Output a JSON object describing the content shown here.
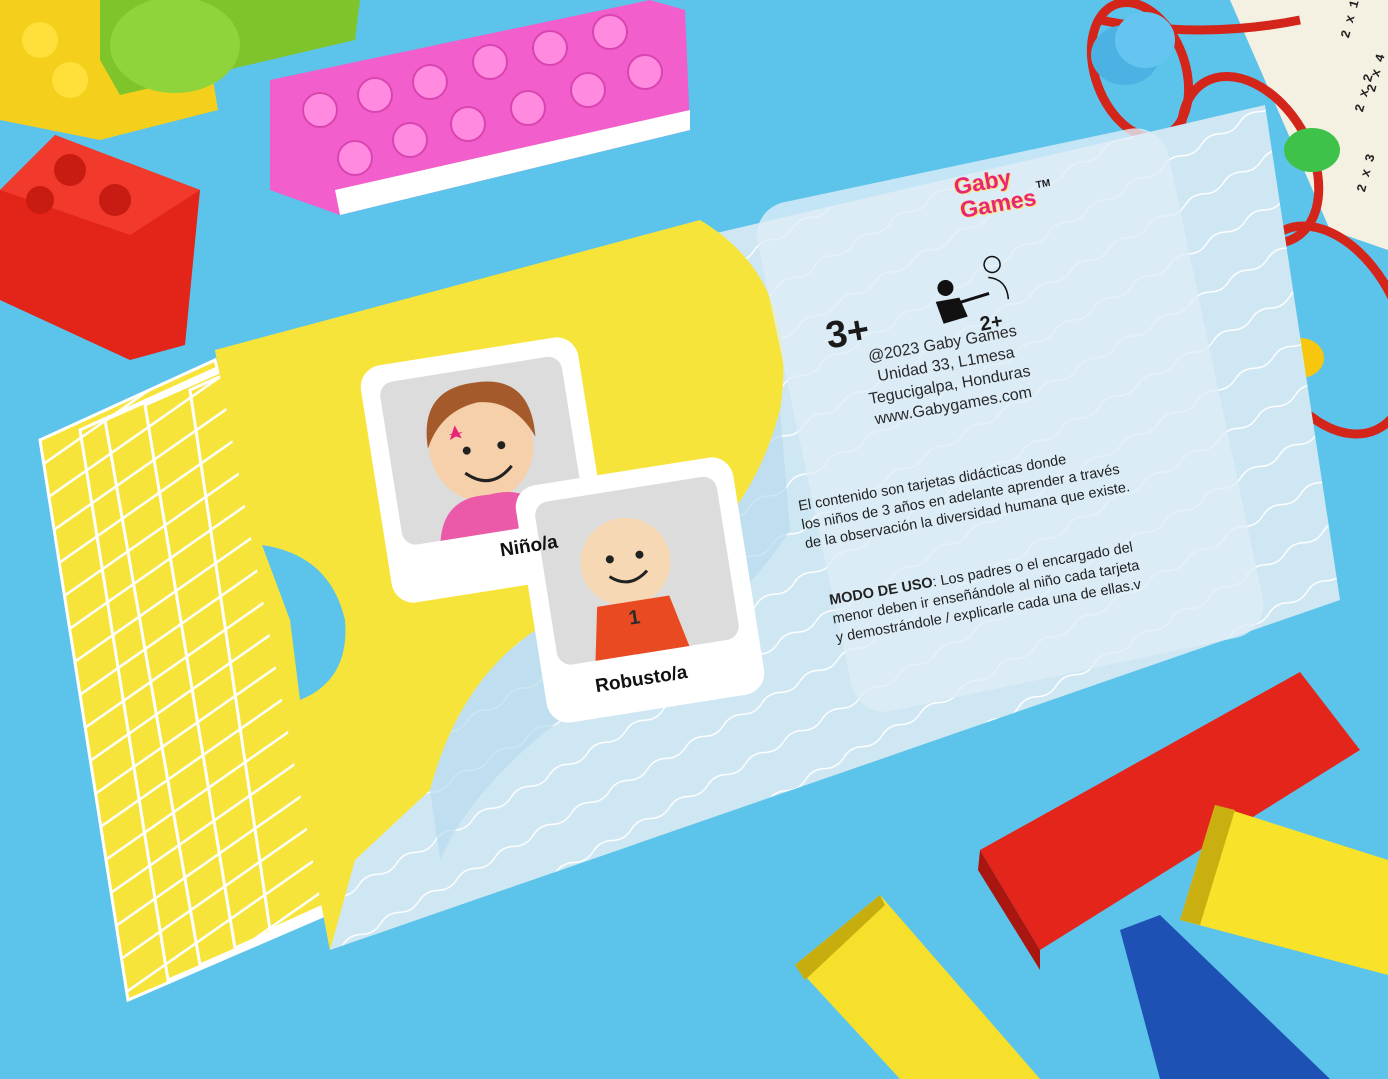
{
  "box": {
    "brand_line1": "Gaby",
    "brand_line2": "Games",
    "trademark": "TM",
    "age_rating": "3+",
    "players": "2+",
    "address": [
      "@2023 Gaby Games",
      "Unidad 33, L1mesa",
      "Tegucigalpa, Honduras",
      "www.Gabygames.com"
    ],
    "description": [
      "El contenido son tarjetas didácticas donde",
      "los niños de 3 años en adelante aprender a través",
      "de la observación la diversidad humana que existe."
    ],
    "usage_title": "MODO DE USO",
    "usage_lines": [
      ": Los padres o el encargado del",
      "menor deben ir enseñándole al niño cada tarjeta",
      "y demostrándole / explicarle cada una de ellas.v"
    ]
  },
  "cards": [
    {
      "label": "Niño/a"
    },
    {
      "label": "Robusto/a",
      "badge": "1"
    }
  ],
  "abacus": [
    "2 x 1",
    "2 x 2",
    "2 x 3",
    "2 x 4"
  ],
  "colors": {
    "background": "#5cc4ea",
    "brand": "#e8257a",
    "card_yellow": "#f7e43b",
    "box_blue": "#cde7f4"
  }
}
